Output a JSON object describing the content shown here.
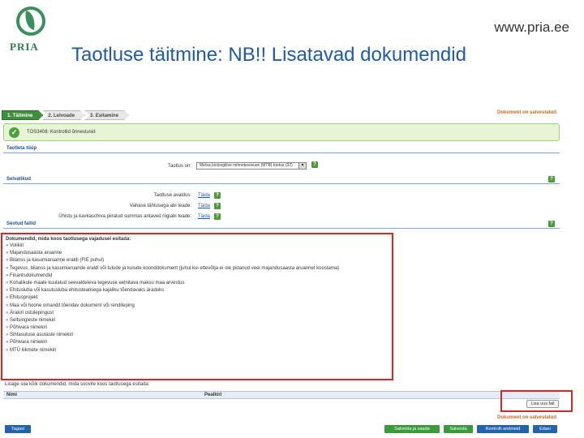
{
  "header": {
    "logo_text": "PRIA",
    "url": "www.pria.ee",
    "title": "Taotluse täitmine: NB!! Lisatavad dokumendid"
  },
  "app": {
    "steps": [
      "1. Täitmine",
      "2. Lelvoade",
      "3. Esitamine"
    ],
    "doc_status": "Dokument on salvestatud",
    "notice": "TOS3408: Kontrollid õnnestusid",
    "section_type": "Taotleta tüüp",
    "type_label": "Taotlus on:",
    "type_value": "Metsa bioloogilise mitmekesisuse (MTB) toetus (32)",
    "section_attachments": "Selvatikud",
    "attachment_rows": [
      {
        "label": "Taotluse avaldus:",
        "link": "Täida"
      },
      {
        "label": "Vahase tähtusega abi teade:",
        "link": "Täida"
      },
      {
        "label": "Ühistu ja kavkaschiva piiratud summas antaved riigiabi teade:",
        "link": "Täida"
      }
    ],
    "section_files": "Seotud failid",
    "doclist_title": "Dokumendid, mida koos taotlusega vajadusel esitada:",
    "doclist_items": [
      "Volikiri",
      "Majandusaasta aruanne",
      "Bilanss ja kasumiaruanne eraldi (FIE puhul)",
      "Tegevus, bilanss ja kasumiaruande eraldi või tulude ja kulude koonddokument (juhul kui ettevõtja ei ole pidanud veel majandusaasta aruannet koostama)",
      "Finantsdokumendid",
      "Kohalikule maale kuulatud seevaldeleva tegevuse eelnitava maksu maa arvestus",
      "Ehitusluba või kasutusluba ehitusteatisega kajaliku tõendavaks äraduks",
      "Ehitusprojekt",
      "Maa või hoone omandit tõendav dokument või rendileping",
      "Ärakiri ostulepingust",
      "Seltsingleste nimekiri",
      "Põhivara nimekiri",
      "Sihtasutuse asutaste nimekiri",
      "Põhivara nimekiri",
      "MTÜ liikmete nimekiri"
    ],
    "upload_note": "Lisage siia kõik dokumendid, mida soovite koos taotlusega esitada:",
    "table_headers": [
      "Nimi",
      "Pealkiri"
    ],
    "upload_button": "Lisa uus fail",
    "doc_status_bottom": "Dokument on salvestatud",
    "buttons": {
      "back": "Tagasi",
      "save_send": "Salvesta ja saada",
      "save": "Salvesta",
      "check": "Kontrolli andmeid",
      "next": "Edasi"
    }
  }
}
